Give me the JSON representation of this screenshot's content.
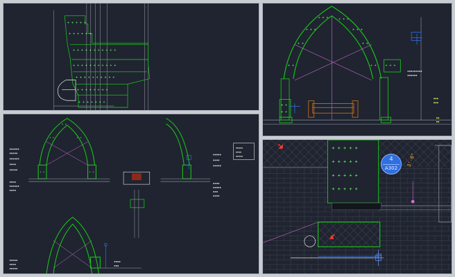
{
  "colors": {
    "background": "#1f2430",
    "brick": "#19c219",
    "brick_light": "#6bff6b",
    "leader": "#d46cd4",
    "callout": "#2f6fe0",
    "wood": "#b2651f",
    "marker": "#ff3b30",
    "gray_line": "#8a8f9a"
  },
  "viewports": {
    "top_left": {
      "name": "column-plan-detail"
    },
    "top_right": {
      "name": "pointed-arch-elevation"
    },
    "bottom_left": {
      "name": "arch-sheet-overview"
    },
    "bottom_right": {
      "name": "footing-section-detail"
    }
  },
  "callout": {
    "number": "4",
    "sheet": "A302"
  },
  "icons": [
    "crosshair-icon",
    "red-arrow-icon"
  ]
}
